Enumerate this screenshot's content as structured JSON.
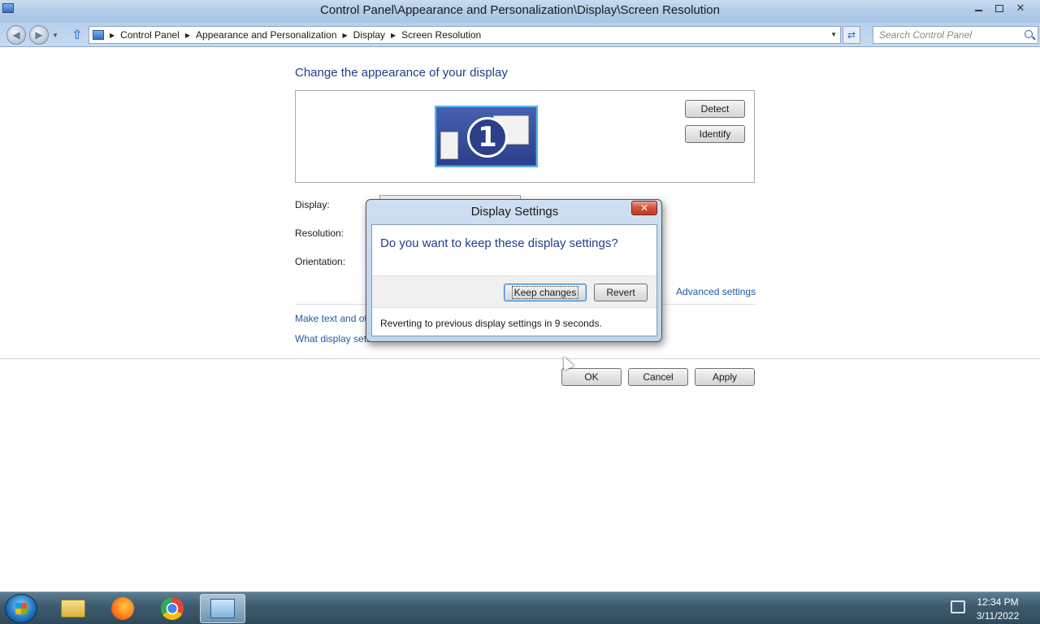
{
  "window": {
    "title": "Control Panel\\Appearance and Personalization\\Display\\Screen Resolution"
  },
  "address_bar": {
    "breadcrumbs": [
      "Control Panel",
      "Appearance and Personalization",
      "Display",
      "Screen Resolution"
    ],
    "search_placeholder": "Search Control Panel"
  },
  "main": {
    "heading": "Change the appearance of your display",
    "monitor_number": "1",
    "detect_label": "Detect",
    "identify_label": "Identify",
    "display_label": "Display:",
    "resolution_label": "Resolution:",
    "orientation_label": "Orientation:",
    "advanced_link": "Advanced settings",
    "link_text_size": "Make text and ot",
    "link_what_settings": "What display setti",
    "ok_label": "OK",
    "cancel_label": "Cancel",
    "apply_label": "Apply"
  },
  "dialog": {
    "title": "Display Settings",
    "close_glyph": "✕",
    "question": "Do you want to keep these display settings?",
    "keep_label": "Keep changes",
    "revert_label": "Revert",
    "revert_note": "Reverting to previous display settings in 9 seconds."
  },
  "taskbar": {
    "time": "12:34 PM",
    "date": "3/11/2022"
  },
  "colors": {
    "heading_blue": "#1e3f8a",
    "link_blue": "#1e5aa8",
    "close_red": "#c23b22"
  }
}
